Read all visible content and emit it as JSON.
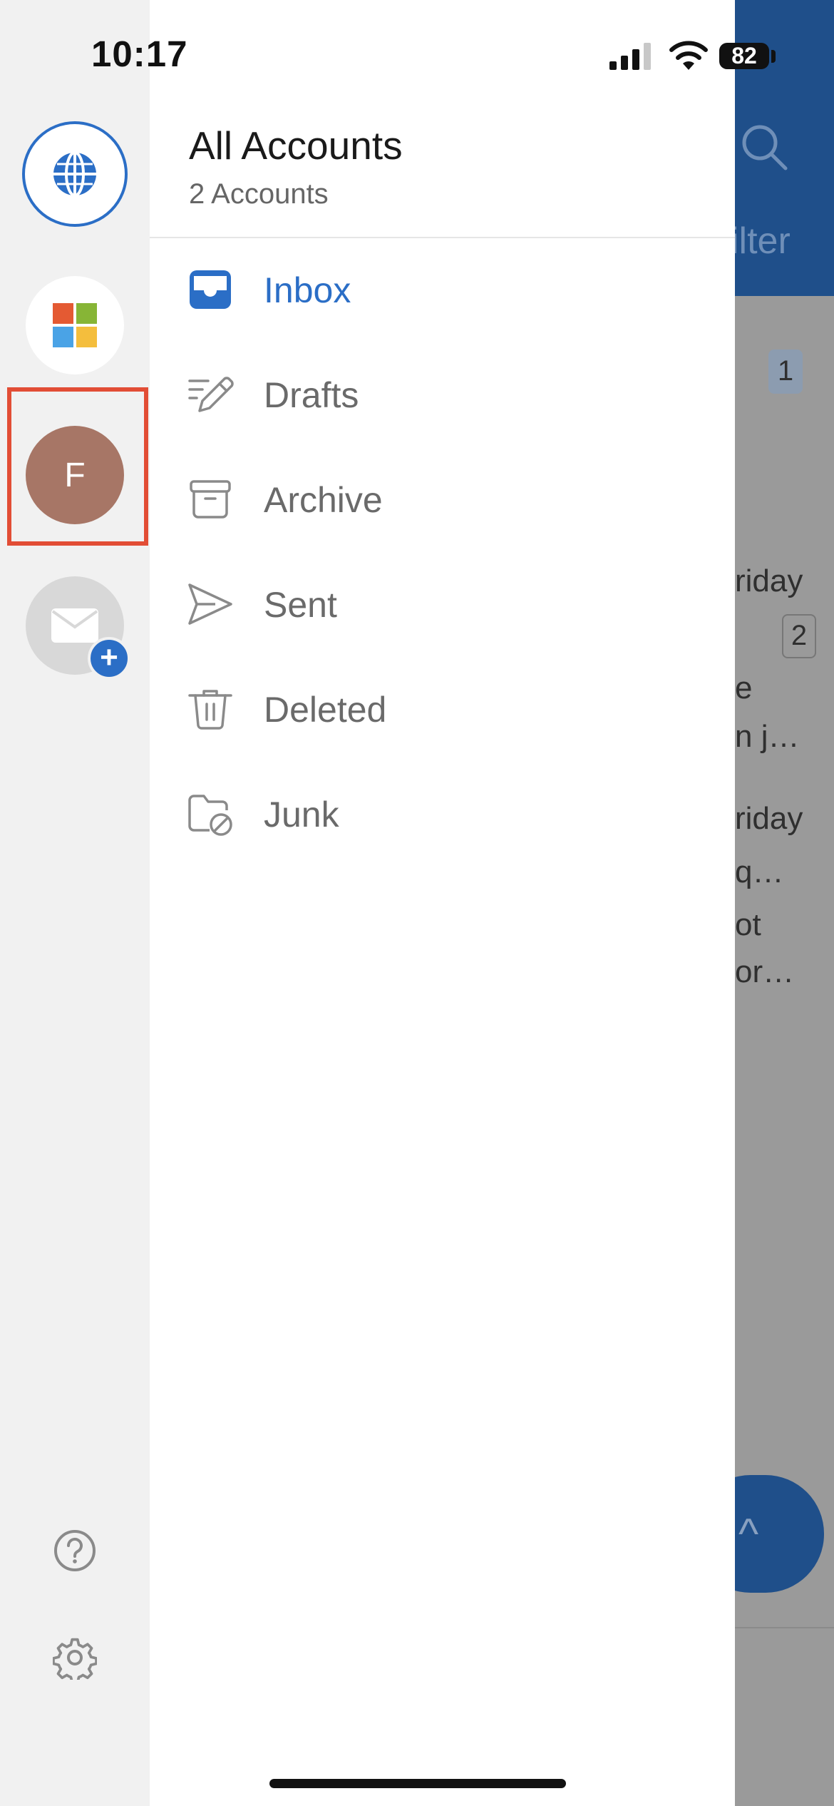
{
  "status_bar": {
    "time": "10:17",
    "battery": "82"
  },
  "drawer": {
    "title": "All Accounts",
    "subtitle": "2 Accounts",
    "folders": [
      {
        "label": "Inbox",
        "icon": "inbox-icon",
        "active": true
      },
      {
        "label": "Drafts",
        "icon": "drafts-icon",
        "active": false
      },
      {
        "label": "Archive",
        "icon": "archive-icon",
        "active": false
      },
      {
        "label": "Sent",
        "icon": "sent-icon",
        "active": false
      },
      {
        "label": "Deleted",
        "icon": "trash-icon",
        "active": false
      },
      {
        "label": "Junk",
        "icon": "junk-icon",
        "active": false
      }
    ]
  },
  "rail": {
    "accounts": [
      {
        "name": "all-accounts",
        "icon": "globe-icon"
      },
      {
        "name": "microsoft-account",
        "icon": "microsoft-logo-icon"
      },
      {
        "name": "f-account",
        "initial": "F",
        "color": "#a77666"
      },
      {
        "name": "add-account",
        "icon": "mail-plus-icon"
      }
    ]
  },
  "background": {
    "header_text": "ilter",
    "badge_1": "1",
    "row1_day": "riday",
    "badge_2": "2",
    "row1_line1": "e",
    "row1_line2": "n j…",
    "row2_day": "riday",
    "row2_line1": "q…",
    "row2_line2": "ot",
    "row2_line3": "or…"
  },
  "colors": {
    "accent": "#2b6ec6",
    "highlight": "#e24d35",
    "avatar_f": "#a77666"
  }
}
